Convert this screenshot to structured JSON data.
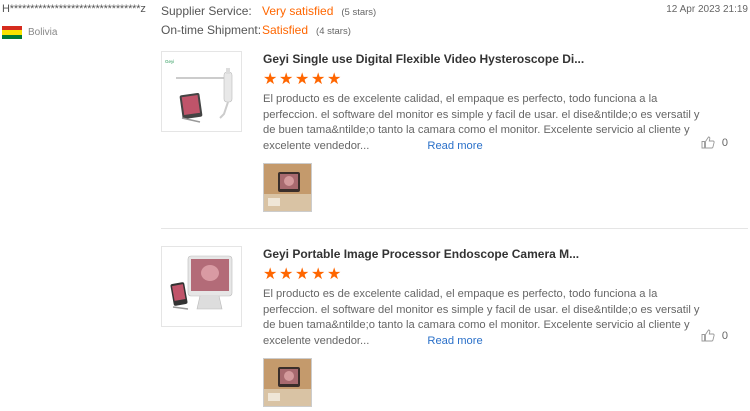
{
  "buyer": {
    "name": "H********************************z",
    "country": "Bolivia",
    "flag_colors": [
      "#d52b1e",
      "#f9e300",
      "#007934"
    ]
  },
  "ratings": [
    {
      "label": "Supplier Service:",
      "value": "Very satisfied",
      "stars": "(5 stars)"
    },
    {
      "label": "On-time Shipment:",
      "value": "Satisfied",
      "stars": "(4 stars)"
    }
  ],
  "date": "12 Apr 2023 21:19",
  "reviews": [
    {
      "title": "Geyi Single use Digital Flexible Video Hysteroscope Di...",
      "thumb_brand": "Geyi",
      "text": "El producto es de excelente calidad, el empaque es perfecto,  todo funciona a la perfeccion. el software del monitor es simple y facil de usar. el dise&ntilde;o es versatil y de buen tama&ntilde;o tanto la camara como el monitor. Excelente servicio al cliente y excelente vendedor...",
      "read_more": "Read more",
      "likes": "0"
    },
    {
      "title": "Geyi Portable Image Processor Endoscope Camera M...",
      "text": "El producto es de excelente calidad, el empaque es perfecto,  todo funciona a la perfeccion. el software del monitor es simple y facil de usar. el dise&ntilde;o es versatil y de buen tama&ntilde;o tanto la camara como el monitor. Excelente servicio al cliente y excelente vendedor...",
      "read_more": "Read more",
      "likes": "0"
    }
  ],
  "colors": {
    "accent": "#ff6600",
    "link": "#2a70c9"
  },
  "icons": {
    "star": "star-icon",
    "like": "thumbs-up-icon"
  }
}
